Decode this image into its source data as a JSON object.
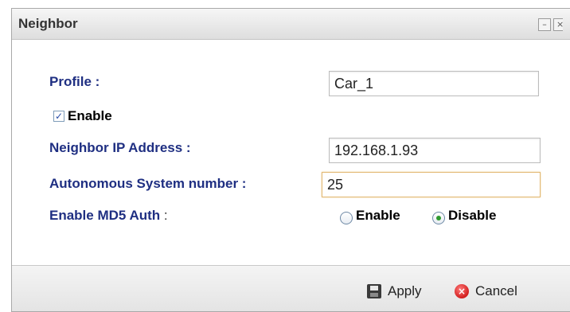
{
  "dialog": {
    "title": "Neighbor",
    "minimize_glyph": "–",
    "close_glyph": "×"
  },
  "form": {
    "profile_label": "Profile :",
    "profile_value": "Car_1",
    "enable_checkbox": {
      "label": "Enable",
      "checked": true,
      "glyph": "✓"
    },
    "neighbor_ip_label": "Neighbor IP Address :",
    "neighbor_ip_value": "192.168.1.93",
    "as_number_label": "Autonomous System number :",
    "as_number_value": "25",
    "md5_label": "Enable MD5 Auth",
    "md5_label_suffix": " :",
    "md5_options": [
      {
        "label": "Enable",
        "selected": false
      },
      {
        "label": "Disable",
        "selected": true
      }
    ]
  },
  "footer": {
    "apply_label": "Apply",
    "cancel_label": "Cancel",
    "cancel_glyph": "×"
  },
  "colors": {
    "label_color": "#1f2f82",
    "focus_border": "#e2b871",
    "radio_selected": "#2f9a2f",
    "cancel_icon": "#d21f1f"
  }
}
